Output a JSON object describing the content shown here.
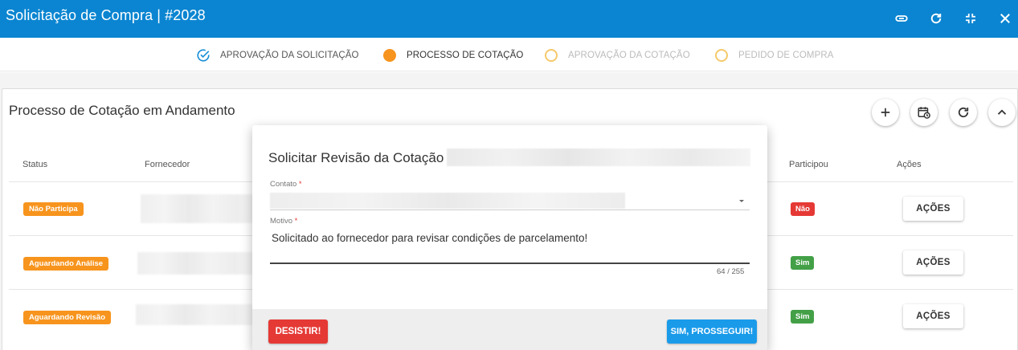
{
  "titlebar": {
    "title": "Solicitação de Compra | #2028",
    "icons": [
      "paperclip-icon",
      "refresh-icon",
      "collapse-icon",
      "close-icon"
    ]
  },
  "stepper": {
    "steps": [
      {
        "label": "APROVAÇÃO DA SOLICITAÇÃO",
        "state": "done"
      },
      {
        "label": "PROCESSO DE COTAÇÃO",
        "state": "active"
      },
      {
        "label": "APROVAÇÃO DA COTAÇÃO",
        "state": "pending"
      },
      {
        "label": "PEDIDO DE COMPRA",
        "state": "pending"
      }
    ]
  },
  "panel": {
    "title": "Processo de Cotação em Andamento",
    "columns": {
      "status": "Status",
      "fornecedor": "Fornecedor",
      "participou": "Participou",
      "acoes": "Ações"
    },
    "rows": [
      {
        "status": "Não Participa",
        "participou": "Não",
        "action": "AÇÕES"
      },
      {
        "status": "Aguardando Análise",
        "participou": "Sim",
        "action": "AÇÕES"
      },
      {
        "status": "Aguardando Revisão",
        "participou": "Sim",
        "action": "AÇÕES"
      }
    ]
  },
  "modal": {
    "title": "Solicitar Revisão da Cotação |",
    "contato_label": "Contato",
    "motivo_label": "Motivo",
    "required_mark": "*",
    "motivo_value": "Solicitado ao fornecedor para revisar condições de parcelamento!",
    "counter": "64 / 255",
    "cancel_label": "DESISTIR!",
    "confirm_label": "SIM, PROSSEGUIR!"
  },
  "colors": {
    "titlebar": "#0b85d1",
    "orange": "#f7941d",
    "red": "#e53935",
    "green": "#43a047",
    "blue": "#1a9bea"
  }
}
